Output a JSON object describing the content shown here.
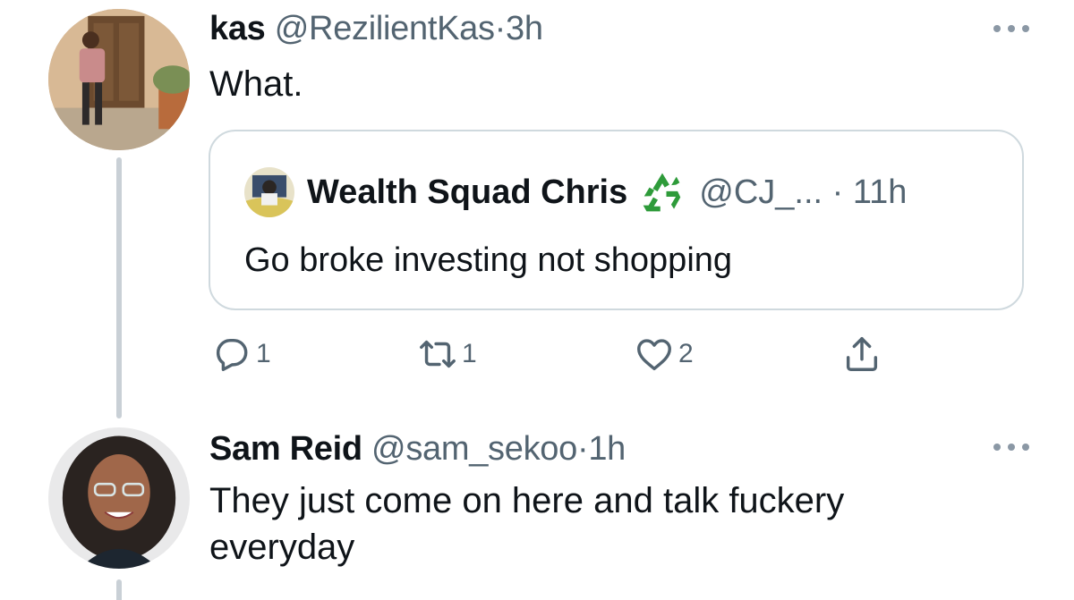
{
  "tweets": [
    {
      "display_name": "kas",
      "handle": "@RezilientKas",
      "separator": "·",
      "time": "3h",
      "text": "What.",
      "quoted": {
        "display_name": "Wealth Squad Chris",
        "badge_icon": "recycle-icon",
        "handle": "@CJ_...",
        "separator": "·",
        "time": "11h",
        "text": "Go broke investing not shopping"
      },
      "actions": {
        "reply_count": "1",
        "retweet_count": "1",
        "like_count": "2"
      }
    },
    {
      "display_name": "Sam Reid",
      "handle": "@sam_sekoo",
      "separator": "·",
      "time": "1h",
      "text_line_1": "They just come on here and talk fuckery",
      "text_line_2": "everyday"
    }
  ],
  "colors": {
    "text_primary": "#0f1419",
    "text_secondary": "#536471",
    "border": "#cfd9de",
    "thread_line": "#c9d0d6",
    "recycle_green": "#2e9b3a"
  }
}
